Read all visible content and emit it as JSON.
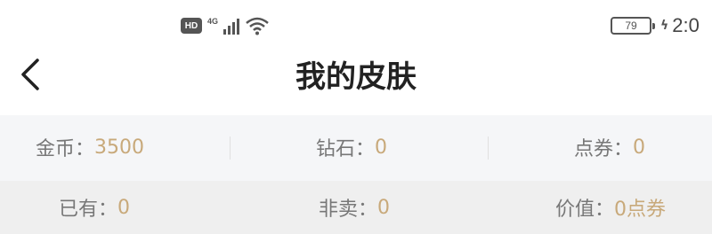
{
  "status_bar": {
    "hd_badge": "HD",
    "network": "4G",
    "battery_level": "79",
    "time": "2:0"
  },
  "header": {
    "back_icon": "chevron-left-icon",
    "title": "我的皮肤"
  },
  "currency": {
    "gold": {
      "label": "金币：",
      "value": "3500"
    },
    "diamond": {
      "label": "钻石：",
      "value": "0"
    },
    "coupon": {
      "label": "点券：",
      "value": "0"
    }
  },
  "summary": {
    "owned": {
      "label": "已有：",
      "value": "0"
    },
    "not_for_sale": {
      "label": "非卖：",
      "value": "0"
    },
    "worth": {
      "label": "价值：",
      "value": "0点券"
    }
  },
  "colors": {
    "value_accent": "#c8a97a",
    "label_gray": "#777777",
    "header_bg": "#ffffff",
    "currency_bg": "#f5f6f8",
    "summary_bg": "#efefef"
  }
}
